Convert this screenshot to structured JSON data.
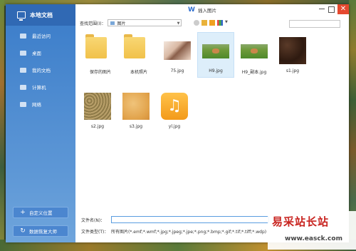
{
  "dialog": {
    "title": "插入图片"
  },
  "sidebar": {
    "header": "本地文档",
    "items": [
      {
        "label": "最近访问",
        "icon": "clock-icon"
      },
      {
        "label": "桌面",
        "icon": "desktop-icon"
      },
      {
        "label": "我的文档",
        "icon": "folder-icon"
      },
      {
        "label": "计算机",
        "icon": "computer-icon"
      },
      {
        "label": "网络",
        "icon": "network-icon"
      }
    ],
    "custom_location": "自定义位置",
    "data_recovery": "数据恢复大师"
  },
  "toolbar": {
    "lookin_label": "查找范围(I)：",
    "lookin_value": "图片"
  },
  "files": [
    {
      "label": "保存的图片",
      "kind": "folder"
    },
    {
      "label": "本机照片",
      "kind": "folder"
    },
    {
      "label": "75.jpg",
      "kind": "image"
    },
    {
      "label": "H9.jpg",
      "kind": "image",
      "selected": true
    },
    {
      "label": "H9_副本.jpg",
      "kind": "image"
    },
    {
      "label": "s1.jpg",
      "kind": "image"
    },
    {
      "label": "s2.jpg",
      "kind": "image"
    },
    {
      "label": "s3.jpg",
      "kind": "image"
    },
    {
      "label": "yl.jpg",
      "kind": "image"
    }
  ],
  "form": {
    "filename_label": "文件名(N)：",
    "filename_value": "",
    "filetype_label": "文件类型(T)：",
    "filetype_value": "所有图片(*.emf;*.wmf;*.jpg;*.jpeg;*.jpe;*.png;*.bmp;*.gif;*.tif;*.tiff;*.wdp)"
  },
  "watermark": {
    "cn": "易采站长站",
    "url": "www.easck.com"
  },
  "colors": {
    "sidebar": "#3a7cc9",
    "accent": "#2f6fd0",
    "close": "#e5492f"
  }
}
